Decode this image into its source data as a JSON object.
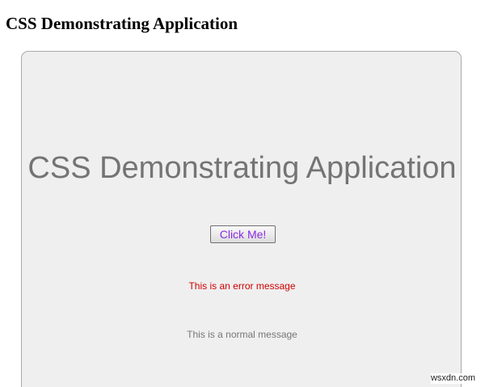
{
  "page": {
    "heading": "CSS Demonstrating Application"
  },
  "panel": {
    "title": "CSS Demonstrating Application",
    "button_label": "Click Me!",
    "error_message": "This is an error message",
    "normal_message": "This is a normal message"
  },
  "watermark": "wsxdn.com",
  "colors": {
    "panel_background": "#efefef",
    "title_text": "#747474",
    "button_text": "#8a2be2",
    "error_text": "#d10000",
    "normal_text": "#777777"
  }
}
